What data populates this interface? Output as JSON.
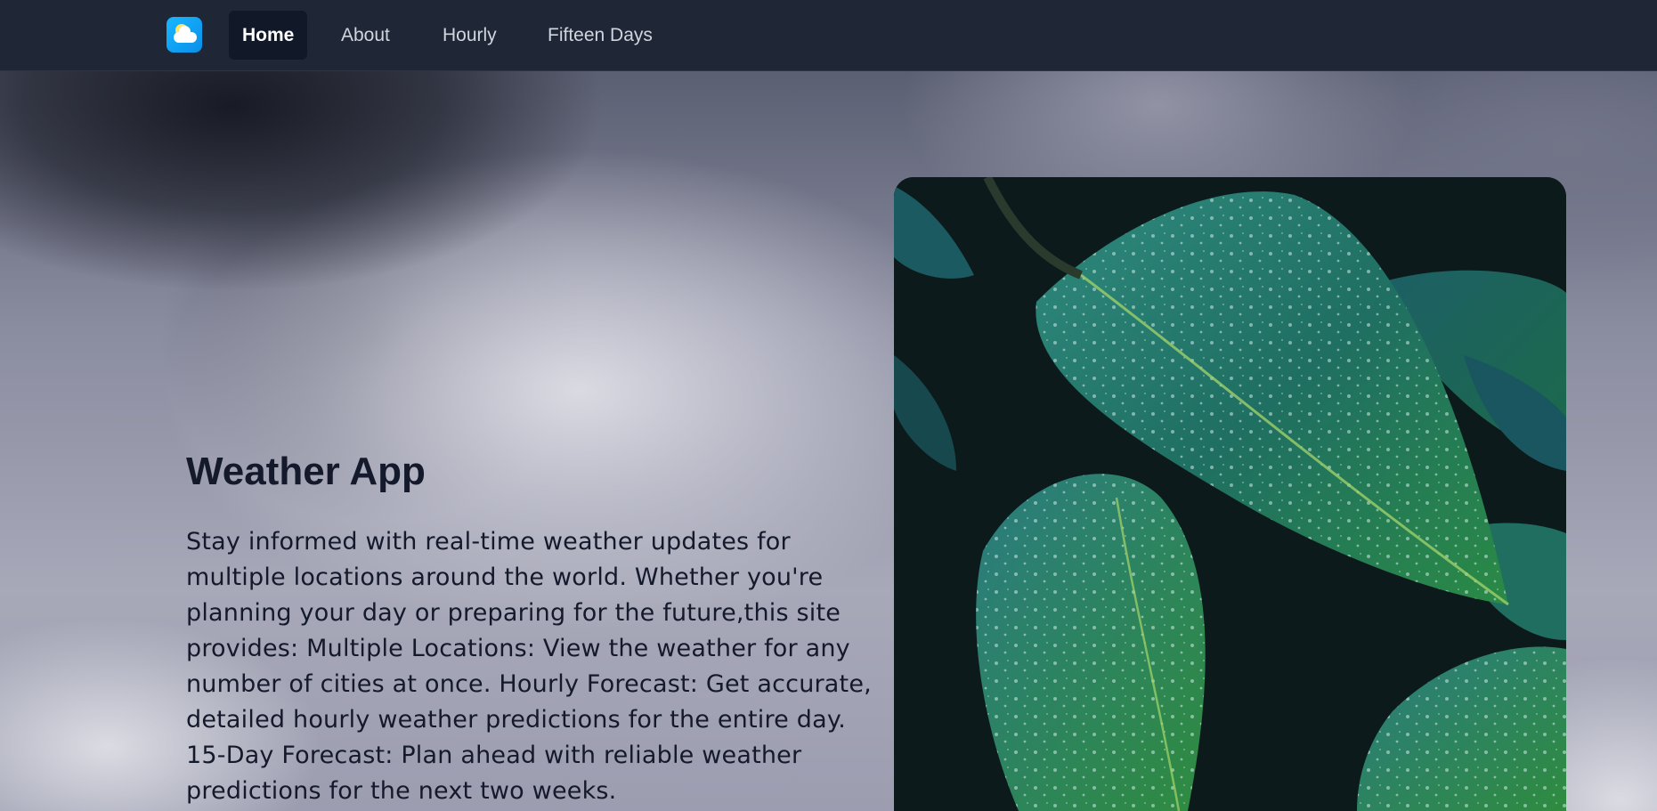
{
  "nav": {
    "logo_icon": "weather-cloud-sun-icon",
    "items": [
      {
        "label": "Home",
        "active": true
      },
      {
        "label": "About",
        "active": false
      },
      {
        "label": "Hourly",
        "active": false
      },
      {
        "label": "Fifteen Days",
        "active": false
      }
    ]
  },
  "hero": {
    "title": "Weather App",
    "description": "Stay informed with real-time weather updates for multiple locations around the world. Whether you're planning your day or preparing for the future,this site provides: Multiple Locations: View the weather for any number of cities at once. Hourly Forecast: Get accurate, detailed hourly weather predictions for the entire day. 15-Day Forecast: Plan ahead with reliable weather predictions for the next two weeks.",
    "image_icon": "leaves-with-raindrops-image"
  },
  "colors": {
    "navbar": "#1f2737",
    "nav_active": "#111827",
    "text_dark": "#141a2b",
    "logo_blue": "#0a8ee8"
  }
}
